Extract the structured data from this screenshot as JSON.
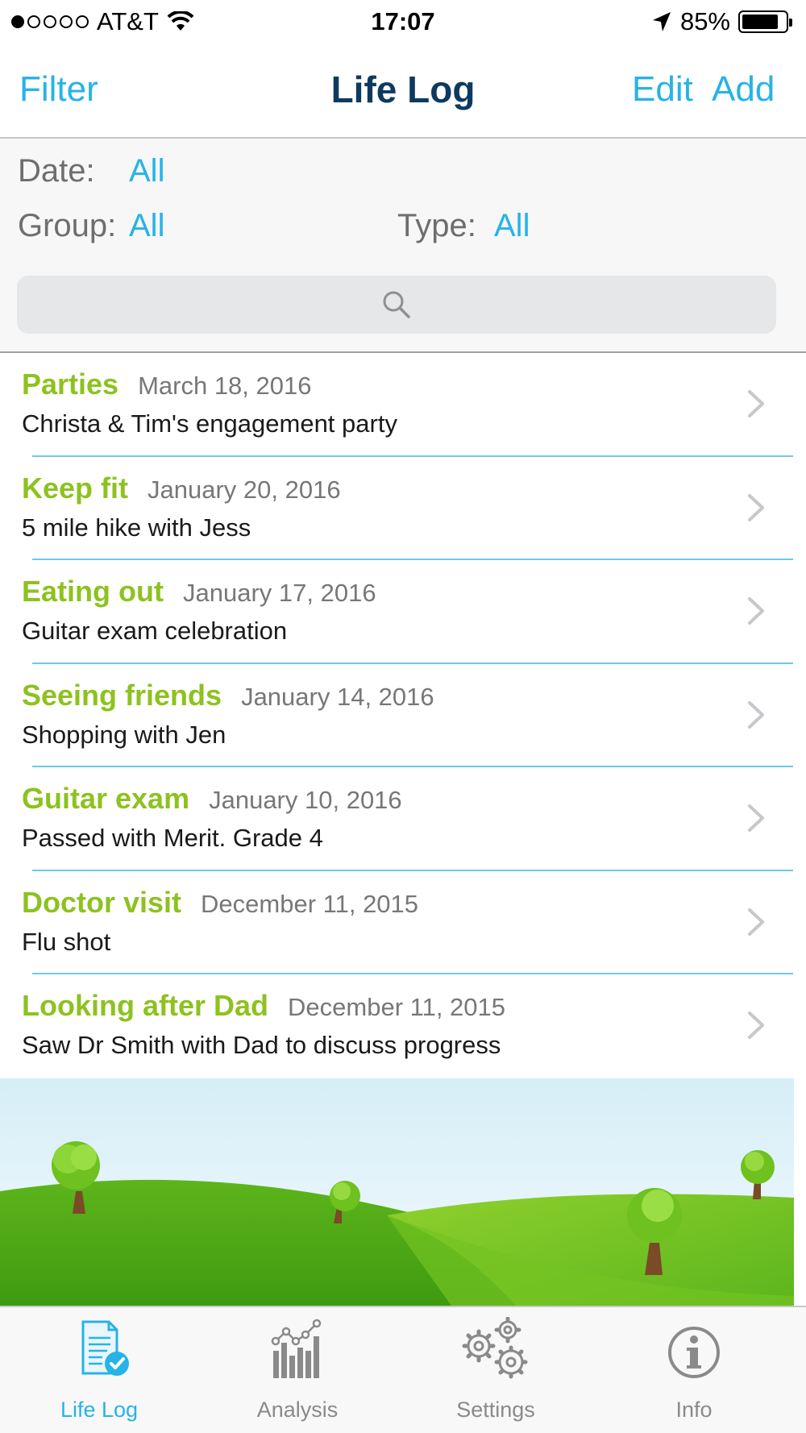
{
  "status_bar": {
    "carrier": "AT&T",
    "time": "17:07",
    "battery": "85%",
    "battery_level": 0.85,
    "signal_bars": 1
  },
  "nav": {
    "left_button": "Filter",
    "title": "Life Log",
    "edit_button": "Edit",
    "add_button": "Add"
  },
  "filters": {
    "date_label": "Date:",
    "date_value": "All",
    "group_label": "Group:",
    "group_value": "All",
    "type_label": "Type:",
    "type_value": "All"
  },
  "search": {
    "placeholder": ""
  },
  "entries": [
    {
      "group": "Parties",
      "date": "March 18, 2016",
      "description": "Christa & Tim's engagement party"
    },
    {
      "group": "Keep fit",
      "date": "January 20, 2016",
      "description": "5 mile hike with Jess"
    },
    {
      "group": "Eating out",
      "date": "January 17, 2016",
      "description": "Guitar exam celebration"
    },
    {
      "group": "Seeing friends",
      "date": "January 14, 2016",
      "description": "Shopping with Jen"
    },
    {
      "group": "Guitar exam",
      "date": "January 10, 2016",
      "description": "Passed with Merit. Grade 4"
    },
    {
      "group": "Doctor visit",
      "date": "December 11, 2015",
      "description": "Flu shot"
    },
    {
      "group": "Looking after Dad",
      "date": "December 11, 2015",
      "description": "Saw Dr Smith with Dad to discuss progress"
    }
  ],
  "tabs": [
    {
      "label": "Life Log",
      "icon": "life-log-icon",
      "active": true
    },
    {
      "label": "Analysis",
      "icon": "analysis-icon",
      "active": false
    },
    {
      "label": "Settings",
      "icon": "settings-icon",
      "active": false
    },
    {
      "label": "Info",
      "icon": "info-icon",
      "active": false
    }
  ],
  "colors": {
    "accent": "#27b3e6",
    "title": "#0f3a5f",
    "group_text": "#8dc21f",
    "separator": "#6ec8ea"
  }
}
